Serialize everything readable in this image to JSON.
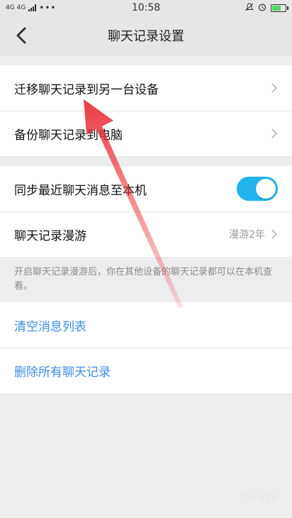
{
  "statusbar": {
    "network": "4G 4G",
    "time": "10:58",
    "icons": [
      "signal-icon",
      "mute-icon",
      "alarm-icon",
      "battery-icon"
    ]
  },
  "header": {
    "title": "聊天记录设置",
    "back_icon": "chevron-left-icon"
  },
  "group1": {
    "items": [
      {
        "label": "迁移聊天记录到另一台设备"
      },
      {
        "label": "备份聊天记录到电脑"
      }
    ]
  },
  "group2": {
    "sync": {
      "label": "同步最近聊天消息至本机",
      "enabled": true
    },
    "roaming": {
      "label": "聊天记录漫游",
      "value": "漫游2年"
    }
  },
  "hint": "开启聊天记录漫游后，你在其他设备的聊天记录都可以在本机查看。",
  "group3": {
    "clear_list": "清空消息列表",
    "delete_all": "删除所有聊天记录"
  },
  "watermark": {
    "text": "Bai 经验"
  },
  "colors": {
    "accent_blue": "#3d8ee3",
    "toggle_on": "#20b3ee",
    "annotation_arrow": "#e8333a",
    "background": "#ededf0"
  }
}
